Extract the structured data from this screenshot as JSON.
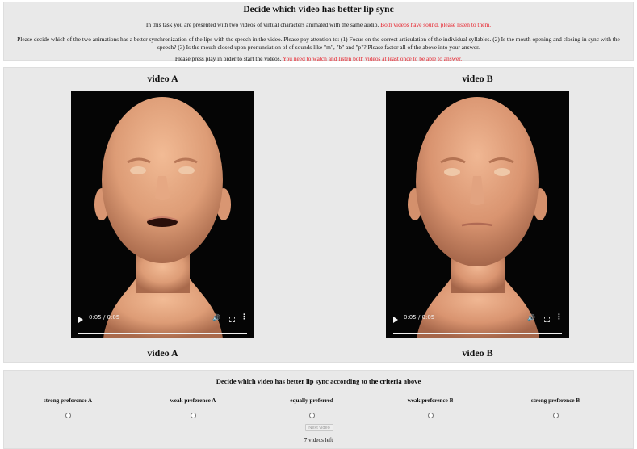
{
  "instructions": {
    "title": "Decide which video has better lip sync",
    "line1_text": "In this task you are presented with two videos of virtual characters animated with the same audio.",
    "line1_red": "Both videos have sound, please listen to them.",
    "line2_text": "Please decide which of the two animations has a better synchronization of the lips with the speech in the video. Please pay attention to: (1) Focus on the correct articulation of the individual syllables. (2) Is the mouth opening and closing in sync with the speech? (3) Is the mouth closed upon pronunciation of of sounds like \"m\", \"b\" and \"p\"? Please factor all of the above into your answer.",
    "line3_text": "Please press play in order to start the videos.",
    "line3_red": "You need to watch and listen both videos at least once to be able to answer."
  },
  "videos": {
    "a": {
      "label_top": "video A",
      "label_bottom": "video A",
      "time": "0:05 / 0:05",
      "progress": 1.0
    },
    "b": {
      "label_top": "video B",
      "label_bottom": "video B",
      "time": "0:05 / 0:05",
      "progress": 1.0
    }
  },
  "icons": {
    "play": "play-icon",
    "volume": "volume-icon",
    "fullscreen": "fullscreen-icon",
    "more": "more-vertical-icon"
  },
  "rating": {
    "title": "Decide which video has better lip sync according to the criteria above",
    "options": [
      {
        "label": "strong preference A",
        "selected": false
      },
      {
        "label": "weak preference A",
        "selected": false
      },
      {
        "label": "equally preferred",
        "selected": false
      },
      {
        "label": "weak preference B",
        "selected": false
      },
      {
        "label": "strong preference B",
        "selected": false
      }
    ],
    "next_label": "Next video",
    "next_enabled": false,
    "videos_left": "7 videos left"
  },
  "colors": {
    "panel": "#e9e9e9",
    "warning": "#e8202a",
    "video_bg": "#050505",
    "skin": "#e3a27c"
  }
}
